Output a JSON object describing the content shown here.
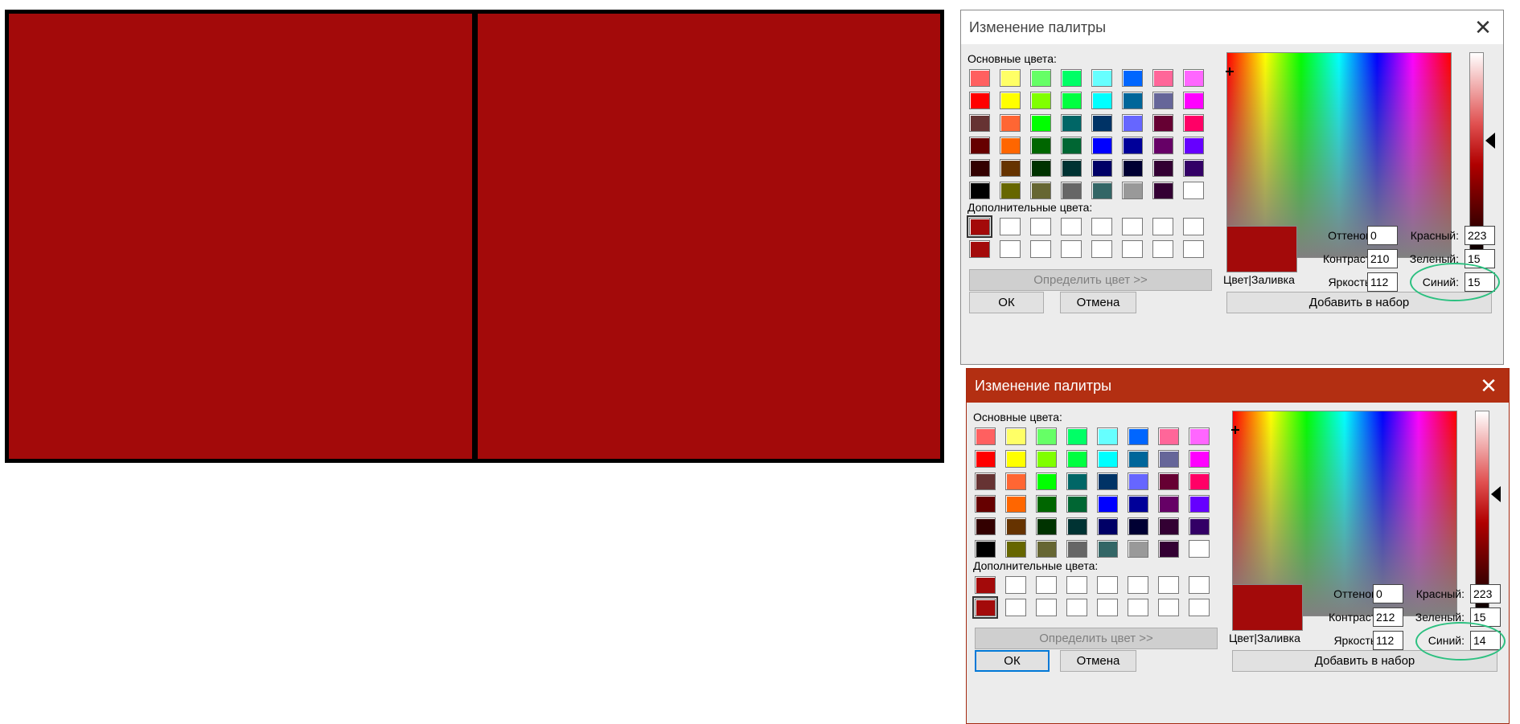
{
  "comparison": {
    "left_color": "#a30a0a",
    "right_color": "#a30a0a"
  },
  "dialogs": [
    {
      "title": "Изменение палитры",
      "basic_label": "Основные цвета:",
      "custom_label": "Дополнительные цвета:",
      "define_button": "Определить цвет >>",
      "ok_button": "ОК",
      "cancel_button": "Отмена",
      "add_button": "Добавить в набор",
      "preview_label": "Цвет|Заливка",
      "preview_color": "#a30a0a",
      "fields": {
        "hue_label": "Оттенок:",
        "hue": "0",
        "sat_label": "Контраст:",
        "sat": "210",
        "lum_label": "Яркость:",
        "lum": "112",
        "red_label": "Красный:",
        "red": "223",
        "green_label": "Зеленый:",
        "green": "15",
        "blue_label": "Синий:",
        "blue": "15"
      },
      "selected_custom": 0
    },
    {
      "title": "Изменение палитры",
      "basic_label": "Основные цвета:",
      "custom_label": "Дополнительные цвета:",
      "define_button": "Определить цвет >>",
      "ok_button": "ОК",
      "cancel_button": "Отмена",
      "add_button": "Добавить в набор",
      "preview_label": "Цвет|Заливка",
      "preview_color": "#a30a0a",
      "fields": {
        "hue_label": "Оттенок:",
        "hue": "0",
        "sat_label": "Контраст:",
        "sat": "212",
        "lum_label": "Яркость:",
        "lum": "112",
        "red_label": "Красный:",
        "red": "223",
        "green_label": "Зеленый:",
        "green": "15",
        "blue_label": "Синий:",
        "blue": "14"
      },
      "selected_custom": 8
    }
  ],
  "basic_colors": [
    "#ff6060",
    "#ffff66",
    "#66ff66",
    "#00ff66",
    "#66ffff",
    "#0066ff",
    "#ff6699",
    "#ff66ff",
    "#ff0000",
    "#ffff00",
    "#80ff00",
    "#00ff40",
    "#00ffff",
    "#00669a",
    "#666699",
    "#ff00ff",
    "#663333",
    "#ff6633",
    "#00ff00",
    "#006666",
    "#003366",
    "#6666ff",
    "#660033",
    "#ff0066",
    "#660000",
    "#ff6600",
    "#006600",
    "#006633",
    "#0000ff",
    "#000099",
    "#660066",
    "#6600ff",
    "#330000",
    "#663300",
    "#003300",
    "#003333",
    "#000066",
    "#000033",
    "#330033",
    "#330066",
    "#000000",
    "#666600",
    "#666633",
    "#666666",
    "#336666",
    "#999999",
    "#330033",
    "#ffffff"
  ],
  "custom_colors": [
    "#a30a0a",
    "#ffffff",
    "#ffffff",
    "#ffffff",
    "#ffffff",
    "#ffffff",
    "#ffffff",
    "#ffffff",
    "#a30a0a",
    "#ffffff",
    "#ffffff",
    "#ffffff",
    "#ffffff",
    "#ffffff",
    "#ffffff",
    "#ffffff"
  ]
}
